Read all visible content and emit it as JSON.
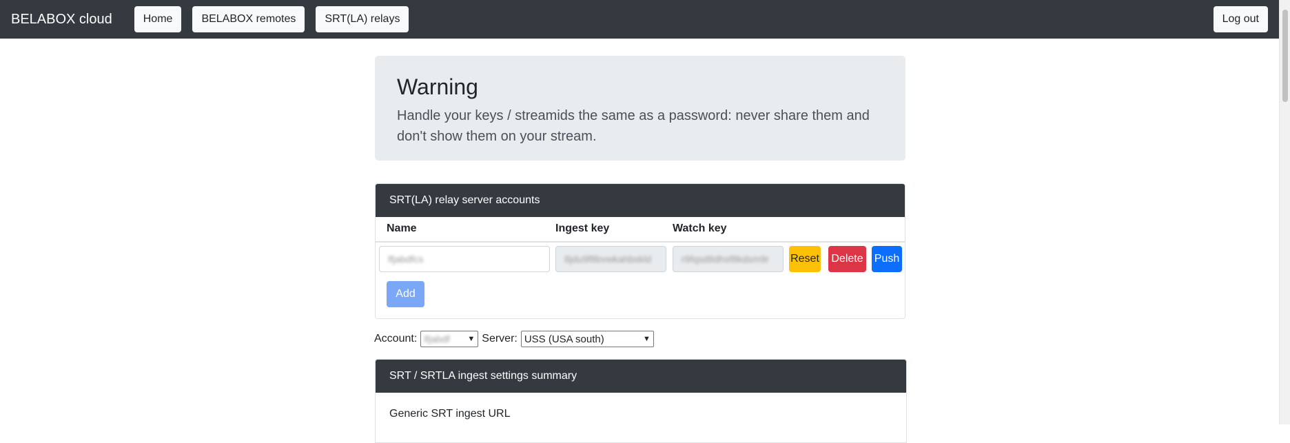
{
  "navbar": {
    "brand": "BELABOX cloud",
    "links": [
      "Home",
      "BELABOX remotes",
      "SRT(LA) relays"
    ],
    "logout": "Log out"
  },
  "warning": {
    "title": "Warning",
    "text": "Handle your keys / streamids the same as a password: never share them and don't show them on your stream."
  },
  "accounts": {
    "header": "SRT(LA) relay server accounts",
    "columns": [
      "Name",
      "Ingest key",
      "Watch key"
    ],
    "rows": [
      {
        "name": "lfjabdfcs",
        "ingest_key": "8jdu9f8bvwkahbskld",
        "watch_key": "r9fqsd8dhsf8kdsm9r",
        "actions": [
          "Reset",
          "Delete",
          "Push"
        ]
      }
    ],
    "add_label": "Add"
  },
  "selectors": {
    "account_label": "Account:",
    "account_value": "lfjabdf",
    "server_label": "Server:",
    "server_value": "USS (USA south)"
  },
  "summary": {
    "header": "SRT / SRTLA ingest settings summary",
    "first_item": "Generic SRT ingest URL"
  },
  "colors": {
    "navbar": "#343a40",
    "warning_bg": "#e9ecef",
    "reset": "#ffc107",
    "delete": "#dc3545",
    "push": "#0d6efd",
    "add_disabled": "#7aa8f7"
  }
}
